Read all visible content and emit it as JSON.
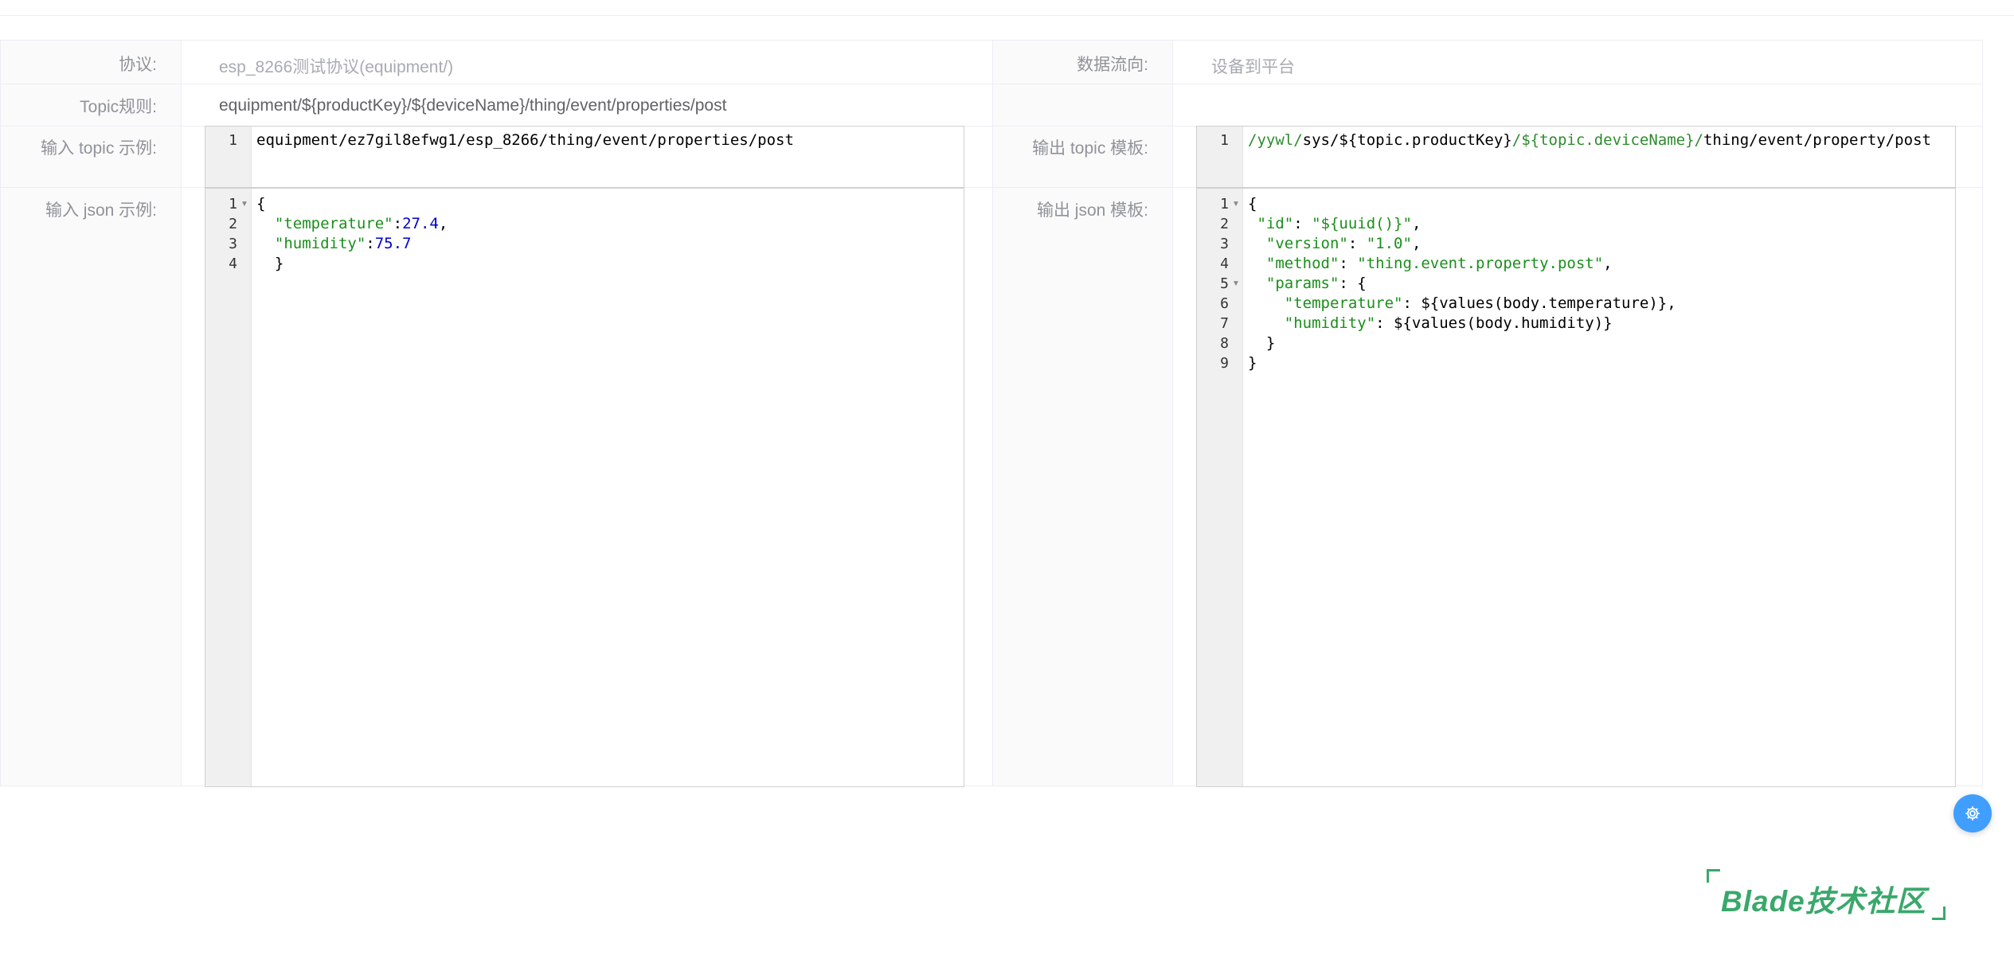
{
  "form": {
    "protocol": {
      "label": "协议:",
      "value": "esp_8266测试协议(equipment/)"
    },
    "data_flow": {
      "label": "数据流向:",
      "value": "设备到平台"
    },
    "topic_rule": {
      "label": "Topic规则:",
      "value": "equipment/${productKey}/${deviceName}/thing/event/properties/post"
    },
    "input_topic": {
      "label": "输入 topic 示例:",
      "lines": [
        {
          "n": "1",
          "text": "equipment/ez7gil8efwg1/esp_8266/thing/event/properties/post"
        }
      ]
    },
    "output_topic": {
      "label": "输出 topic 模板:",
      "line_number": "1",
      "segments": [
        "/yywl/",
        "sys/${topic.productKey}",
        "/${topic.deviceName}/",
        "thing/event/property/post"
      ]
    },
    "input_json": {
      "label": "输入 json 示例:",
      "lines": [
        {
          "n": "1",
          "open": "{"
        },
        {
          "n": "2",
          "indent": "  ",
          "key": "\"temperature\"",
          "sep": ":",
          "val": "27.4",
          "tail": ","
        },
        {
          "n": "3",
          "indent": "  ",
          "key": "\"humidity\"",
          "sep": ":",
          "val": "75.7",
          "tail": ""
        },
        {
          "n": "4",
          "close": "  }"
        }
      ]
    },
    "output_json": {
      "label": "输出 json 模板:",
      "lines": [
        {
          "n": "1",
          "pre": "{",
          "key": "",
          "mid": "",
          "str": "",
          "post": ""
        },
        {
          "n": "2",
          "pre": " ",
          "key": "\"id\"",
          "mid": ": ",
          "str": "\"${uuid()}\"",
          "post": ","
        },
        {
          "n": "3",
          "pre": "  ",
          "key": "\"version\"",
          "mid": ": ",
          "str": "\"1.0\"",
          "post": ","
        },
        {
          "n": "4",
          "pre": "  ",
          "key": "\"method\"",
          "mid": ": ",
          "str": "\"thing.event.property.post\"",
          "post": ","
        },
        {
          "n": "5",
          "pre": "  ",
          "key": "\"params\"",
          "mid": ": {",
          "str": "",
          "post": ""
        },
        {
          "n": "6",
          "pre": "    ",
          "key": "\"temperature\"",
          "mid": ": ${values(body.temperature)},",
          "str": "",
          "post": ""
        },
        {
          "n": "7",
          "pre": "    ",
          "key": "\"humidity\"",
          "mid": ": ${values(body.humidity)}",
          "str": "",
          "post": ""
        },
        {
          "n": "8",
          "pre": "  }",
          "key": "",
          "mid": "",
          "str": "",
          "post": ""
        },
        {
          "n": "9",
          "pre": "}",
          "key": "",
          "mid": "",
          "str": "",
          "post": ""
        }
      ]
    }
  },
  "floating_button": {
    "icon": "gear-icon",
    "color": "#409eff"
  },
  "watermark": {
    "text": "Blade技术社区",
    "color": "#3aa86b"
  }
}
